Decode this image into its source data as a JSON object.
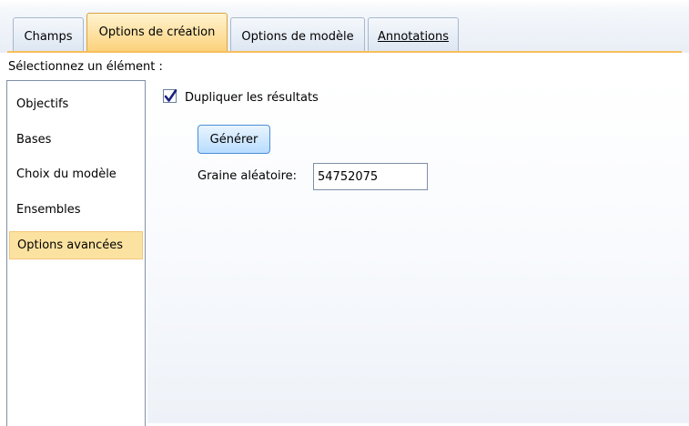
{
  "tabs": [
    {
      "label": "Champs",
      "active": false
    },
    {
      "label": "Options de création",
      "active": true
    },
    {
      "label": "Options de modèle",
      "active": false
    },
    {
      "label": "Annotations",
      "active": false
    }
  ],
  "prompt": "Sélectionnez un élément :",
  "sidebar": {
    "items": [
      {
        "label": "Objectifs"
      },
      {
        "label": "Bases"
      },
      {
        "label": "Choix du modèle"
      },
      {
        "label": "Ensembles"
      },
      {
        "label": "Options avancées",
        "selected": true
      }
    ]
  },
  "options": {
    "duplicate_label": "Dupliquer les résultats",
    "duplicate_checked": true,
    "generate_label": "Générer",
    "seed_label": "Graine aléatoire:",
    "seed_value": "54752075"
  },
  "colors": {
    "active_tab": "#fcd27c",
    "selected_item": "#fce2a0",
    "accent_line": "#f7be5b",
    "button": "#b9dcff"
  }
}
